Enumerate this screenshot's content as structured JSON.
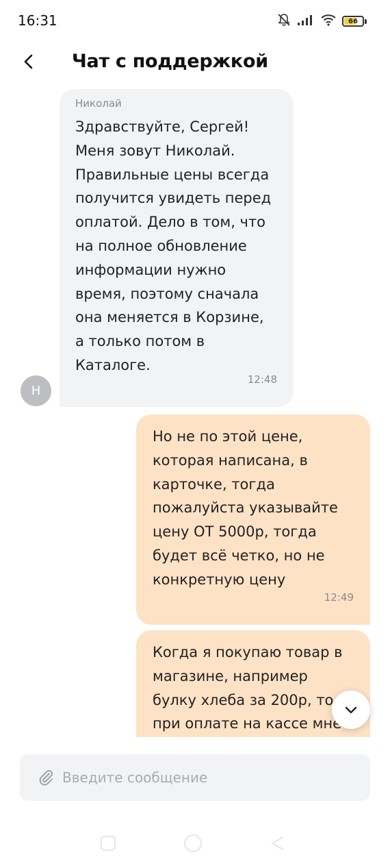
{
  "status_bar": {
    "time": "16:31",
    "battery_level": "66",
    "icons": [
      "bell-muted-icon",
      "signal-icon",
      "wifi-icon",
      "battery-icon"
    ]
  },
  "header": {
    "title": "Чат с поддержкой",
    "back_icon": "chevron-left-icon"
  },
  "messages": [
    {
      "direction": "incoming",
      "sender": "Николай",
      "avatar_letter": "Н",
      "text": "Здравствуйте, Сергей!\nМеня зовут Николай.\nПравильные цены всегда\nполучится увидеть перед\nоплатой. Дело в том, что\nна полное обновление\nинформации нужно\nвремя, поэтому сначала\nона меняется в Корзине,\nа только потом в\nКаталоге.",
      "time": "12:48"
    },
    {
      "direction": "outgoing",
      "text": "Но не по этой цене,\nкоторая написана, в\nкарточке, тогда\nпожалуйста указывайте\nцену ОТ 5000р, тогда\nбудет всё четко, но не\nконкретную цену",
      "time": "12:49"
    },
    {
      "direction": "outgoing",
      "text": "Когда я покупаю товар в\nмагазине, например\nбулку хлеба за 200р, то\nпри оплате на кассе мне"
    }
  ],
  "scroll_button_icon": "chevron-down-icon",
  "composer": {
    "placeholder": "Введите сообщение",
    "attach_icon": "paperclip-icon"
  },
  "nav_bar": {
    "icons": [
      "recents-icon",
      "home-icon",
      "back-icon"
    ]
  },
  "colors": {
    "incoming_bubble": "#f2f3f5",
    "outgoing_bubble": "#fde2c6",
    "battery_fill": "#f1d23e"
  }
}
